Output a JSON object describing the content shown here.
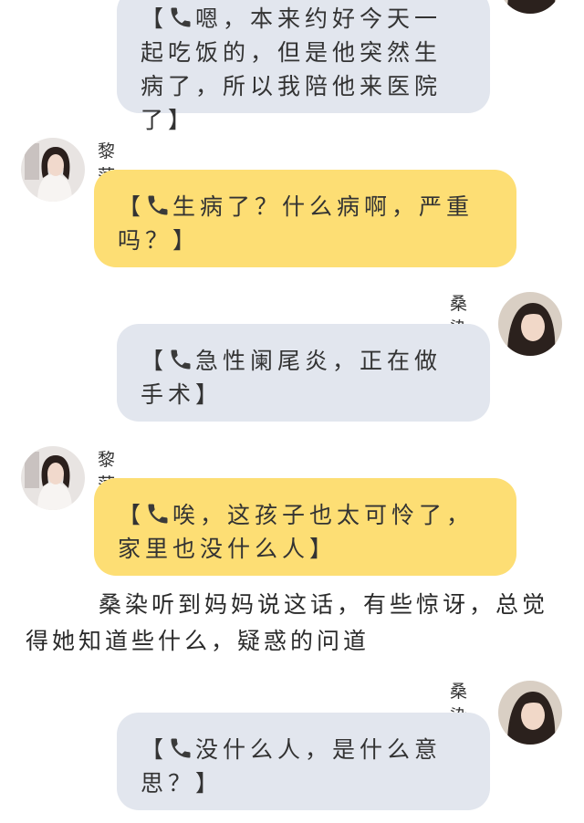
{
  "messages": [
    {
      "sender": "",
      "text": "嗯，本来约好今天一起吃饭的，但是他突然生病了，所以我陪他来医院了"
    },
    {
      "sender": "黎萍",
      "text": "生病了？什么病啊，严重吗？"
    },
    {
      "sender": "桑染",
      "text": "急性阑尾炎，正在做手术"
    },
    {
      "sender": "黎萍",
      "text": "唉，这孩子也太可怜了，家里也没什么人"
    },
    {
      "sender": "桑染",
      "text": "没什么人，是什么意思？"
    }
  ],
  "narration": "桑染听到妈妈说这话，有些惊讶，总觉得她知道些什么，疑惑的问道",
  "bracket_open": "【",
  "bracket_close": "】",
  "icons": {
    "call": "phone-icon",
    "avatar_mom": "avatar-liping",
    "avatar_me": "avatar-sangran"
  },
  "colors": {
    "incoming_bubble": "#fdde74",
    "outgoing_bubble": "#e2e6ee",
    "phone_icon": "#3a3a3a"
  }
}
